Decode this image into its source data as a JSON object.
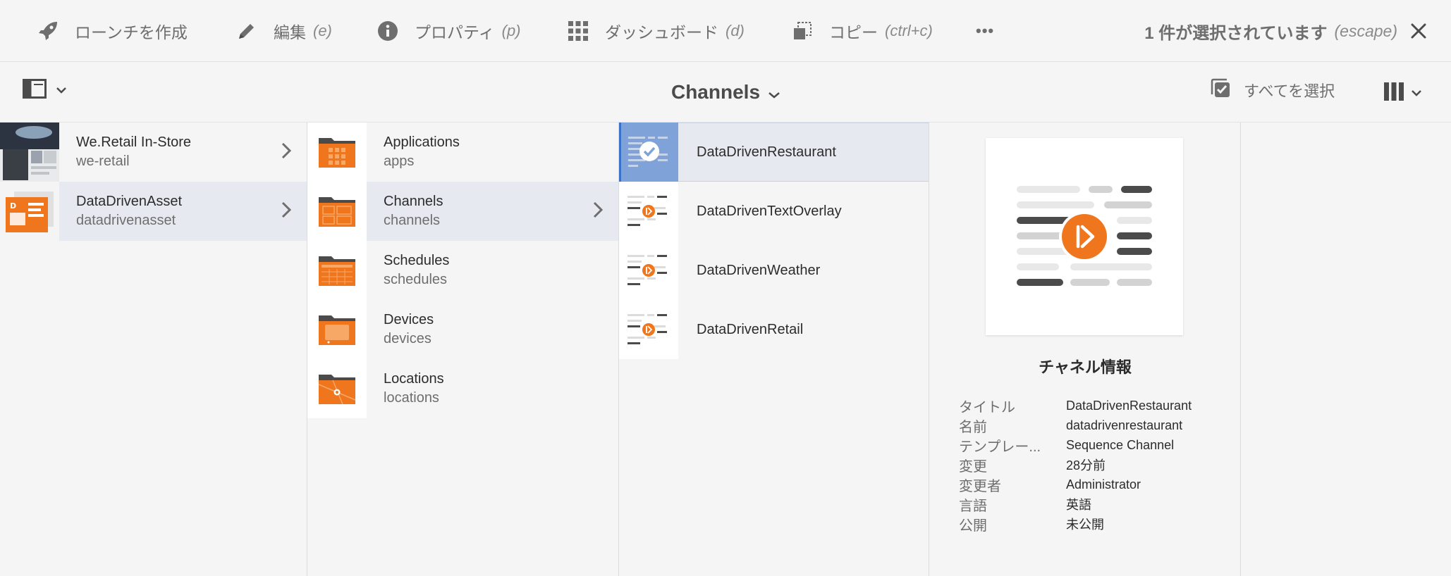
{
  "actionbar": {
    "create_launch": "ローンチを作成",
    "edit": "編集",
    "edit_shortcut": "(e)",
    "properties": "プロパティ",
    "properties_shortcut": "(p)",
    "dashboard": "ダッシュボード",
    "dashboard_shortcut": "(d)",
    "copy": "コピー",
    "copy_shortcut": "(ctrl+c)",
    "more_label": "•••",
    "selection_status": "1 件が選択されています",
    "selection_shortcut": "(escape)"
  },
  "titlebar": {
    "title": "Channels",
    "select_all": "すべてを選択"
  },
  "column1": [
    {
      "title": "We.Retail In-Store",
      "name": "we-retail"
    },
    {
      "title": "DataDrivenAsset",
      "name": "datadrivenasset"
    }
  ],
  "column2": [
    {
      "title": "Applications",
      "name": "apps"
    },
    {
      "title": "Channels",
      "name": "channels"
    },
    {
      "title": "Schedules",
      "name": "schedules"
    },
    {
      "title": "Devices",
      "name": "devices"
    },
    {
      "title": "Locations",
      "name": "locations"
    }
  ],
  "column3": [
    {
      "title": "DataDrivenRestaurant"
    },
    {
      "title": "DataDrivenTextOverlay"
    },
    {
      "title": "DataDrivenWeather"
    },
    {
      "title": "DataDrivenRetail"
    }
  ],
  "preview": {
    "heading": "チャネル情報",
    "meta": [
      {
        "key": "タイトル",
        "value": "DataDrivenRestaurant"
      },
      {
        "key": "名前",
        "value": "datadrivenrestaurant"
      },
      {
        "key": "テンプレー...",
        "value": "Sequence Channel"
      },
      {
        "key": "変更",
        "value": "28分前"
      },
      {
        "key": "変更者",
        "value": "Administrator"
      },
      {
        "key": "言語",
        "value": "英語"
      },
      {
        "key": "公開",
        "value": "未公開"
      }
    ]
  },
  "colors": {
    "accent_orange": "#f0761d",
    "selection_blue": "#3b73c8",
    "active_row": "#e6eaf0"
  }
}
